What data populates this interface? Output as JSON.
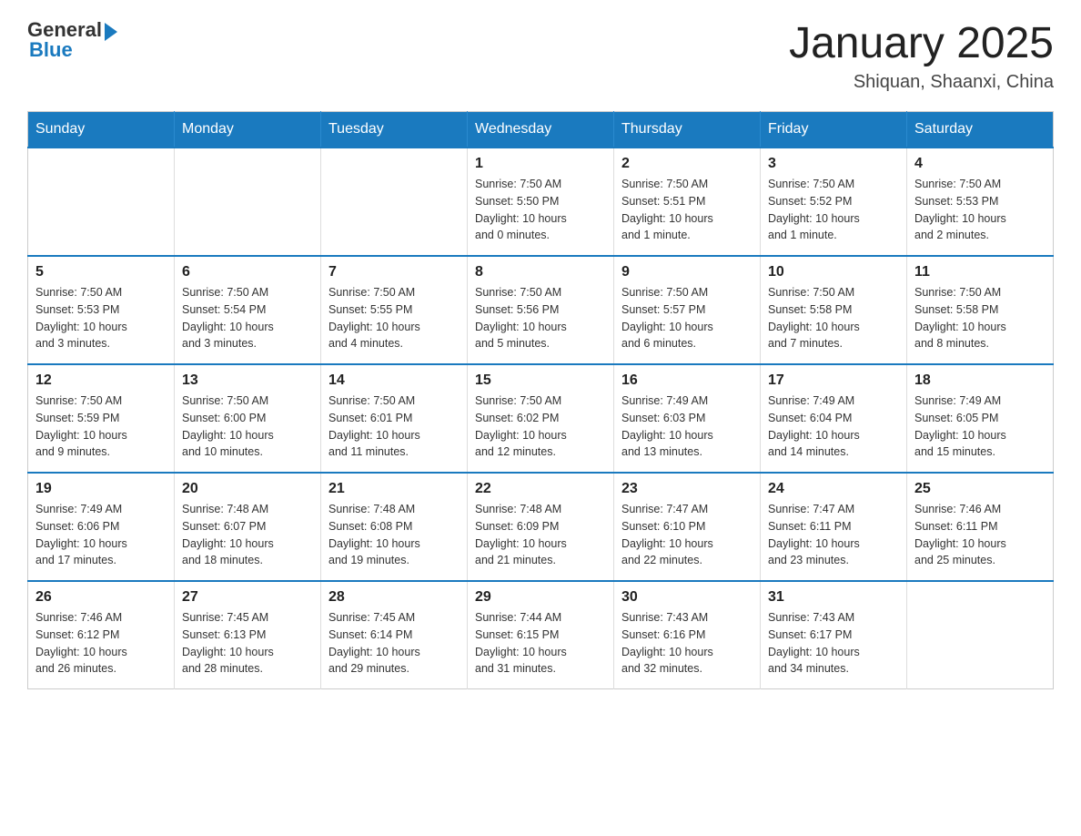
{
  "logo": {
    "general": "General",
    "blue": "Blue"
  },
  "title": "January 2025",
  "subtitle": "Shiquan, Shaanxi, China",
  "days_of_week": [
    "Sunday",
    "Monday",
    "Tuesday",
    "Wednesday",
    "Thursday",
    "Friday",
    "Saturday"
  ],
  "weeks": [
    [
      {
        "day": "",
        "info": ""
      },
      {
        "day": "",
        "info": ""
      },
      {
        "day": "",
        "info": ""
      },
      {
        "day": "1",
        "info": "Sunrise: 7:50 AM\nSunset: 5:50 PM\nDaylight: 10 hours\nand 0 minutes."
      },
      {
        "day": "2",
        "info": "Sunrise: 7:50 AM\nSunset: 5:51 PM\nDaylight: 10 hours\nand 1 minute."
      },
      {
        "day": "3",
        "info": "Sunrise: 7:50 AM\nSunset: 5:52 PM\nDaylight: 10 hours\nand 1 minute."
      },
      {
        "day": "4",
        "info": "Sunrise: 7:50 AM\nSunset: 5:53 PM\nDaylight: 10 hours\nand 2 minutes."
      }
    ],
    [
      {
        "day": "5",
        "info": "Sunrise: 7:50 AM\nSunset: 5:53 PM\nDaylight: 10 hours\nand 3 minutes."
      },
      {
        "day": "6",
        "info": "Sunrise: 7:50 AM\nSunset: 5:54 PM\nDaylight: 10 hours\nand 3 minutes."
      },
      {
        "day": "7",
        "info": "Sunrise: 7:50 AM\nSunset: 5:55 PM\nDaylight: 10 hours\nand 4 minutes."
      },
      {
        "day": "8",
        "info": "Sunrise: 7:50 AM\nSunset: 5:56 PM\nDaylight: 10 hours\nand 5 minutes."
      },
      {
        "day": "9",
        "info": "Sunrise: 7:50 AM\nSunset: 5:57 PM\nDaylight: 10 hours\nand 6 minutes."
      },
      {
        "day": "10",
        "info": "Sunrise: 7:50 AM\nSunset: 5:58 PM\nDaylight: 10 hours\nand 7 minutes."
      },
      {
        "day": "11",
        "info": "Sunrise: 7:50 AM\nSunset: 5:58 PM\nDaylight: 10 hours\nand 8 minutes."
      }
    ],
    [
      {
        "day": "12",
        "info": "Sunrise: 7:50 AM\nSunset: 5:59 PM\nDaylight: 10 hours\nand 9 minutes."
      },
      {
        "day": "13",
        "info": "Sunrise: 7:50 AM\nSunset: 6:00 PM\nDaylight: 10 hours\nand 10 minutes."
      },
      {
        "day": "14",
        "info": "Sunrise: 7:50 AM\nSunset: 6:01 PM\nDaylight: 10 hours\nand 11 minutes."
      },
      {
        "day": "15",
        "info": "Sunrise: 7:50 AM\nSunset: 6:02 PM\nDaylight: 10 hours\nand 12 minutes."
      },
      {
        "day": "16",
        "info": "Sunrise: 7:49 AM\nSunset: 6:03 PM\nDaylight: 10 hours\nand 13 minutes."
      },
      {
        "day": "17",
        "info": "Sunrise: 7:49 AM\nSunset: 6:04 PM\nDaylight: 10 hours\nand 14 minutes."
      },
      {
        "day": "18",
        "info": "Sunrise: 7:49 AM\nSunset: 6:05 PM\nDaylight: 10 hours\nand 15 minutes."
      }
    ],
    [
      {
        "day": "19",
        "info": "Sunrise: 7:49 AM\nSunset: 6:06 PM\nDaylight: 10 hours\nand 17 minutes."
      },
      {
        "day": "20",
        "info": "Sunrise: 7:48 AM\nSunset: 6:07 PM\nDaylight: 10 hours\nand 18 minutes."
      },
      {
        "day": "21",
        "info": "Sunrise: 7:48 AM\nSunset: 6:08 PM\nDaylight: 10 hours\nand 19 minutes."
      },
      {
        "day": "22",
        "info": "Sunrise: 7:48 AM\nSunset: 6:09 PM\nDaylight: 10 hours\nand 21 minutes."
      },
      {
        "day": "23",
        "info": "Sunrise: 7:47 AM\nSunset: 6:10 PM\nDaylight: 10 hours\nand 22 minutes."
      },
      {
        "day": "24",
        "info": "Sunrise: 7:47 AM\nSunset: 6:11 PM\nDaylight: 10 hours\nand 23 minutes."
      },
      {
        "day": "25",
        "info": "Sunrise: 7:46 AM\nSunset: 6:11 PM\nDaylight: 10 hours\nand 25 minutes."
      }
    ],
    [
      {
        "day": "26",
        "info": "Sunrise: 7:46 AM\nSunset: 6:12 PM\nDaylight: 10 hours\nand 26 minutes."
      },
      {
        "day": "27",
        "info": "Sunrise: 7:45 AM\nSunset: 6:13 PM\nDaylight: 10 hours\nand 28 minutes."
      },
      {
        "day": "28",
        "info": "Sunrise: 7:45 AM\nSunset: 6:14 PM\nDaylight: 10 hours\nand 29 minutes."
      },
      {
        "day": "29",
        "info": "Sunrise: 7:44 AM\nSunset: 6:15 PM\nDaylight: 10 hours\nand 31 minutes."
      },
      {
        "day": "30",
        "info": "Sunrise: 7:43 AM\nSunset: 6:16 PM\nDaylight: 10 hours\nand 32 minutes."
      },
      {
        "day": "31",
        "info": "Sunrise: 7:43 AM\nSunset: 6:17 PM\nDaylight: 10 hours\nand 34 minutes."
      },
      {
        "day": "",
        "info": ""
      }
    ]
  ]
}
